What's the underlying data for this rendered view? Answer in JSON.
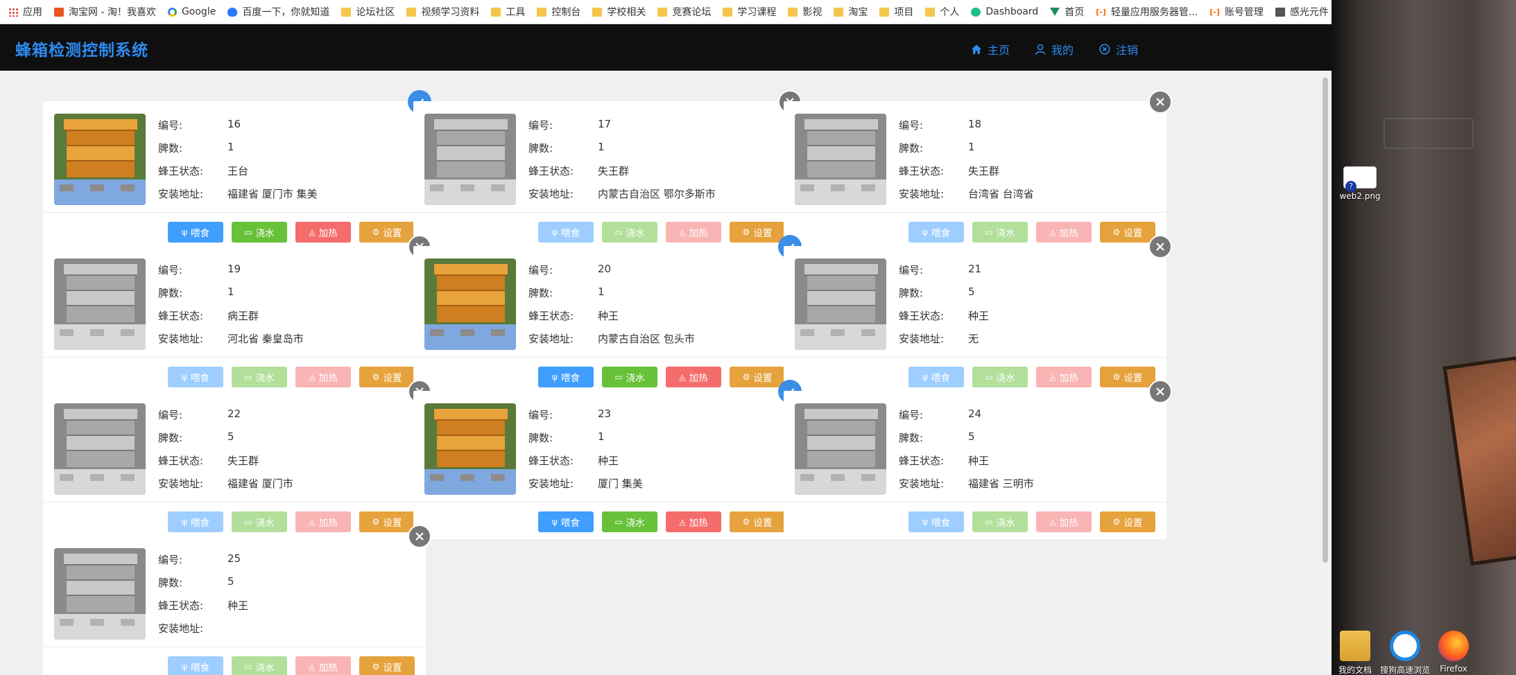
{
  "bookmarks": [
    {
      "icon": "apps-icon",
      "label": "应用"
    },
    {
      "icon": "taobao-icon",
      "label": "淘宝网 - 淘！我喜欢"
    },
    {
      "icon": "google-icon",
      "label": "Google"
    },
    {
      "icon": "baidu-icon",
      "label": "百度一下，你就知道"
    },
    {
      "icon": "folder-icon",
      "label": "论坛社区"
    },
    {
      "icon": "folder-icon",
      "label": "视频学习资料"
    },
    {
      "icon": "folder-icon",
      "label": "工具"
    },
    {
      "icon": "folder-icon",
      "label": "控制台"
    },
    {
      "icon": "folder-icon",
      "label": "学校相关"
    },
    {
      "icon": "folder-icon",
      "label": "竞赛论坛"
    },
    {
      "icon": "folder-icon",
      "label": "学习课程"
    },
    {
      "icon": "folder-icon",
      "label": "影视"
    },
    {
      "icon": "folder-icon",
      "label": "淘宝"
    },
    {
      "icon": "folder-icon",
      "label": "项目"
    },
    {
      "icon": "folder-icon",
      "label": "个人"
    },
    {
      "icon": "dashboard-icon",
      "label": "Dashboard"
    },
    {
      "icon": "vue-icon",
      "label": "首页"
    },
    {
      "icon": "aliyun-icon",
      "label": "轻量应用服务器管..."
    },
    {
      "icon": "aliyun-icon",
      "label": "账号管理"
    },
    {
      "icon": "book-icon",
      "label": "感光元件 · OpenM..."
    }
  ],
  "bookmarks_more": "»",
  "header": {
    "title": "蜂箱检测控制系统",
    "nav_home": "主页",
    "nav_mine": "我的",
    "nav_logout": "注销"
  },
  "labels": {
    "id": "编号:",
    "frames": "脾数:",
    "queen": "蜂王状态:",
    "address": "安装地址:"
  },
  "buttons": {
    "feed": "喂食",
    "water": "浇水",
    "heat": "加热",
    "settings": "设置"
  },
  "colors": {
    "accent": "#2d8cf0",
    "feed": "#409eff",
    "water": "#67c23a",
    "heat": "#f56c6c",
    "settings": "#e6a23c"
  },
  "hives": [
    {
      "id": "16",
      "frames": "1",
      "queen": "王台",
      "address": "福建省 厦门市 集美",
      "online": true
    },
    {
      "id": "17",
      "frames": "1",
      "queen": "失王群",
      "address": "内蒙古自治区 鄂尔多斯市",
      "online": false
    },
    {
      "id": "18",
      "frames": "1",
      "queen": "失王群",
      "address": "台湾省 台湾省",
      "online": false
    },
    {
      "id": "19",
      "frames": "1",
      "queen": "病王群",
      "address": "河北省 秦皇岛市",
      "online": false
    },
    {
      "id": "20",
      "frames": "1",
      "queen": "种王",
      "address": "内蒙古自治区 包头市",
      "online": true
    },
    {
      "id": "21",
      "frames": "5",
      "queen": "种王",
      "address": "无",
      "online": false
    },
    {
      "id": "22",
      "frames": "5",
      "queen": "失王群",
      "address": "福建省 厦门市",
      "online": false
    },
    {
      "id": "23",
      "frames": "1",
      "queen": "种王",
      "address": "厦门 集美",
      "online": true
    },
    {
      "id": "24",
      "frames": "5",
      "queen": "种王",
      "address": "福建省 三明市",
      "online": false
    },
    {
      "id": "25",
      "frames": "5",
      "queen": "种王",
      "address": "",
      "online": false
    }
  ],
  "desktop": {
    "file_label": "web2.png",
    "icons": [
      {
        "label": "我的文档"
      },
      {
        "label": "搜狗高速浏览"
      },
      {
        "label": "Firefox"
      }
    ]
  }
}
